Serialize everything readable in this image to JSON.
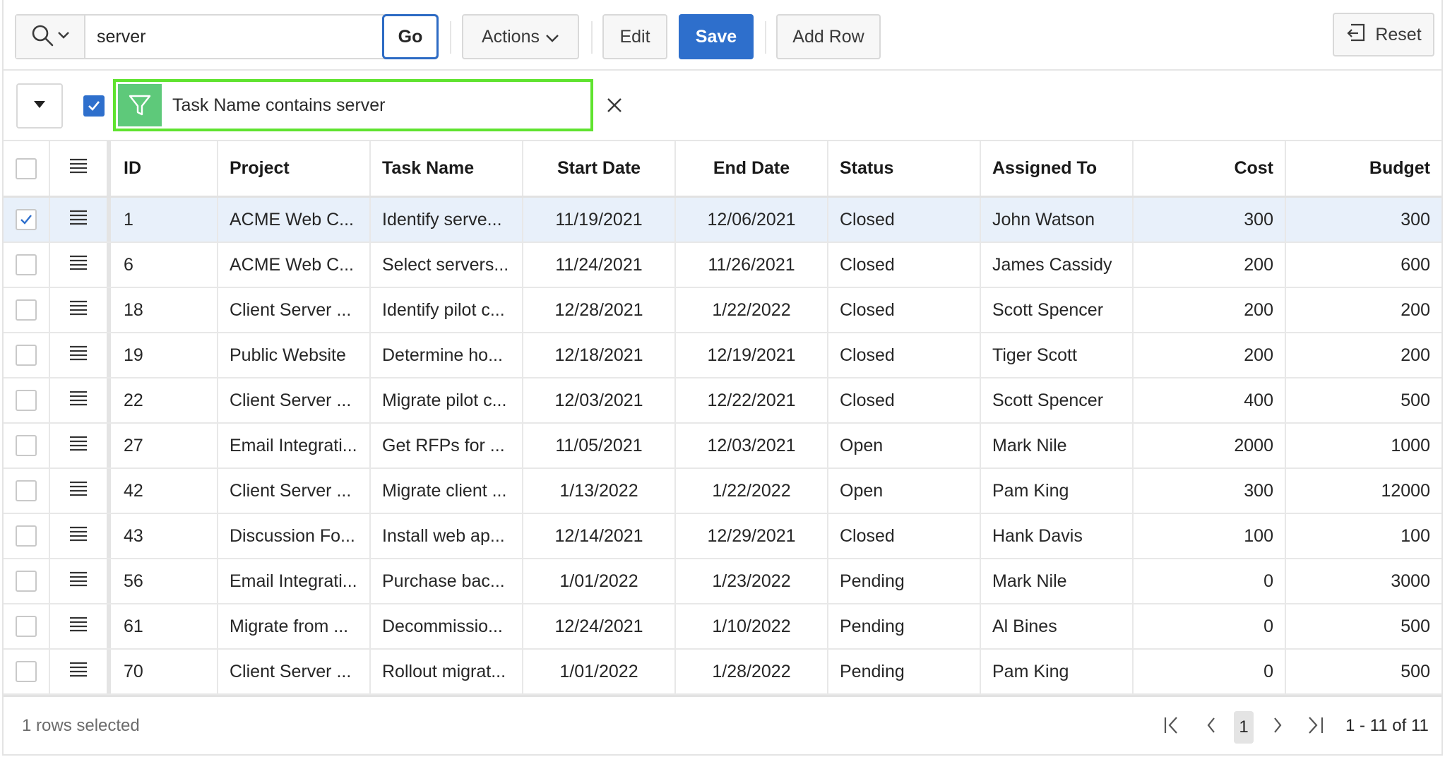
{
  "toolbar": {
    "search_value": "server",
    "search_placeholder": "",
    "go_label": "Go",
    "actions_label": "Actions",
    "edit_label": "Edit",
    "save_label": "Save",
    "add_row_label": "Add Row",
    "reset_label": "Reset"
  },
  "filter": {
    "enabled": true,
    "text": "Task Name contains server"
  },
  "columns": [
    "ID",
    "Project",
    "Task Name",
    "Start Date",
    "End Date",
    "Status",
    "Assigned To",
    "Cost",
    "Budget"
  ],
  "rows": [
    {
      "selected": true,
      "id": "1",
      "project": "ACME Web C...",
      "task": "Identify serve...",
      "start": "11/19/2021",
      "end": "12/06/2021",
      "status": "Closed",
      "assigned": "John Watson",
      "cost": "300",
      "budget": "300"
    },
    {
      "selected": false,
      "id": "6",
      "project": "ACME Web C...",
      "task": "Select servers...",
      "start": "11/24/2021",
      "end": "11/26/2021",
      "status": "Closed",
      "assigned": "James Cassidy",
      "cost": "200",
      "budget": "600"
    },
    {
      "selected": false,
      "id": "18",
      "project": "Client Server ...",
      "task": "Identify pilot c...",
      "start": "12/28/2021",
      "end": "1/22/2022",
      "status": "Closed",
      "assigned": "Scott Spencer",
      "cost": "200",
      "budget": "200"
    },
    {
      "selected": false,
      "id": "19",
      "project": "Public Website",
      "task": "Determine ho...",
      "start": "12/18/2021",
      "end": "12/19/2021",
      "status": "Closed",
      "assigned": "Tiger Scott",
      "cost": "200",
      "budget": "200"
    },
    {
      "selected": false,
      "id": "22",
      "project": "Client Server ...",
      "task": "Migrate pilot c...",
      "start": "12/03/2021",
      "end": "12/22/2021",
      "status": "Closed",
      "assigned": "Scott Spencer",
      "cost": "400",
      "budget": "500"
    },
    {
      "selected": false,
      "id": "27",
      "project": "Email Integrati...",
      "task": "Get RFPs for ...",
      "start": "11/05/2021",
      "end": "12/03/2021",
      "status": "Open",
      "assigned": "Mark Nile",
      "cost": "2000",
      "budget": "1000"
    },
    {
      "selected": false,
      "id": "42",
      "project": "Client Server ...",
      "task": "Migrate client ...",
      "start": "1/13/2022",
      "end": "1/22/2022",
      "status": "Open",
      "assigned": "Pam King",
      "cost": "300",
      "budget": "12000"
    },
    {
      "selected": false,
      "id": "43",
      "project": "Discussion Fo...",
      "task": "Install web ap...",
      "start": "12/14/2021",
      "end": "12/29/2021",
      "status": "Closed",
      "assigned": "Hank Davis",
      "cost": "100",
      "budget": "100"
    },
    {
      "selected": false,
      "id": "56",
      "project": "Email Integrati...",
      "task": "Purchase bac...",
      "start": "1/01/2022",
      "end": "1/23/2022",
      "status": "Pending",
      "assigned": "Mark Nile",
      "cost": "0",
      "budget": "3000"
    },
    {
      "selected": false,
      "id": "61",
      "project": "Migrate from ...",
      "task": "Decommissio...",
      "start": "12/24/2021",
      "end": "1/10/2022",
      "status": "Pending",
      "assigned": "Al Bines",
      "cost": "0",
      "budget": "500"
    },
    {
      "selected": false,
      "id": "70",
      "project": "Client Server ...",
      "task": "Rollout migrat...",
      "start": "1/01/2022",
      "end": "1/28/2022",
      "status": "Pending",
      "assigned": "Pam King",
      "cost": "0",
      "budget": "500"
    }
  ],
  "footer": {
    "status": "1 rows selected",
    "current_page": "1",
    "range": "1 - 11 of 11"
  },
  "colors": {
    "primary": "#2e6fcc",
    "filter_highlight": "#5fe32f",
    "filter_icon_bg": "#5ec97a",
    "selected_row": "#e8f0fa"
  }
}
